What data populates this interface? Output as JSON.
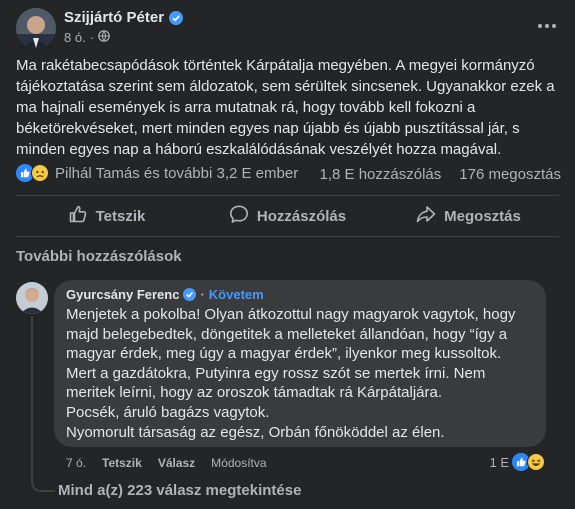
{
  "post": {
    "author": "Szijjártó Péter",
    "time": "8 ó.",
    "separator": "·",
    "text": "Ma rakétabecsapódások történtek Kárpátalja megyében. A megyei kormányzó tájékoztatása szerint sem áldozatok, sem sérültek sincsenek. Ugyanakkor ezek a ma hajnali események is arra mutatnak rá, hogy tovább kell fokozni a béketörekvéseket, mert minden egyes nap újabb és újabb pusztítással jár, s minden egyes nap a háború eszkalálódásának veszélyét hozza magával."
  },
  "reactions": {
    "summary": "Pilhál Tamás és további 3,2 E ember",
    "comments": "1,8 E hozzászólás",
    "shares": "176 megosztás"
  },
  "actions": {
    "like": "Tetszik",
    "comment": "Hozzászólás",
    "share": "Megosztás"
  },
  "comments_section": {
    "more_comments": "További hozzászólások",
    "comment": {
      "author": "Gyurcsány Ferenc",
      "follow": "Követem",
      "lines": [
        "Menjetek a pokolba! Olyan átkozottul nagy magyarok vagytok, hogy majd belegebedtek, döngetitek a melleteket állandóan, hogy “így a magyar érdek, meg úgy a magyar érdek”, ilyenkor meg kussoltok.",
        "Mert a gazdátokra, Putyinra egy rossz szót se mertek írni. Nem meritek leírni, hogy az oroszok támadtak rá Kárpátaljára.",
        "Pocsék, áruló bagázs vagytok.",
        "Nyomorult társaság az egész, Orbán főnököddel az élen."
      ],
      "time": "7 ó.",
      "like": "Tetszik",
      "reply": "Válasz",
      "edited": "Módosítva",
      "reaction_count": "1 E"
    },
    "view_replies": "Mind a(z) 223 válasz megtekintése"
  },
  "colors": {
    "background": "#242526",
    "accent_blue": "#4599ff",
    "bubble": "#3a3b3c",
    "secondary_text": "#b0b3b8"
  },
  "icons": [
    "verified-icon",
    "globe-icon",
    "more-icon",
    "like-reaction-icon",
    "sad-reaction-icon",
    "like-icon",
    "comment-icon",
    "share-icon",
    "laugh-reaction-icon"
  ]
}
